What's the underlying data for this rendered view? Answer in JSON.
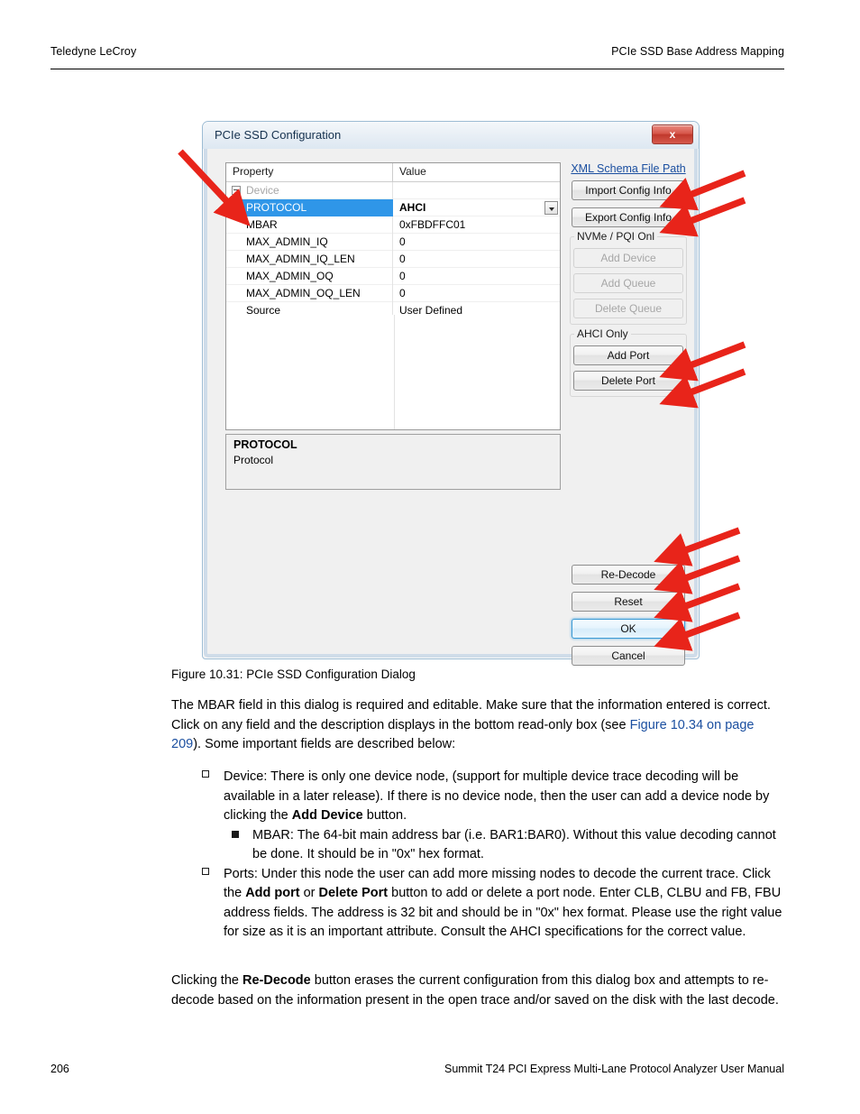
{
  "page": {
    "header_left": "Teledyne LeCroy",
    "header_right": "PCIe SSD Base Address Mapping",
    "footer_page_number": "206",
    "footer_right": "Summit T24 PCI Express Multi-Lane Protocol Analyzer User Manual"
  },
  "dialog": {
    "title": "PCIe SSD Configuration",
    "close_label": "x",
    "grid": {
      "columns": [
        "Property",
        "Value"
      ],
      "rows": [
        {
          "property": "Device",
          "value": "",
          "type": "group",
          "expanded": true
        },
        {
          "property": "PROTOCOL",
          "value": "AHCI",
          "type": "selected-combo"
        },
        {
          "property": "MBAR",
          "value": "0xFBDFFC01",
          "type": "normal"
        },
        {
          "property": "MAX_ADMIN_IQ",
          "value": "0",
          "type": "normal"
        },
        {
          "property": "MAX_ADMIN_IQ_LEN",
          "value": "0",
          "type": "normal"
        },
        {
          "property": "MAX_ADMIN_OQ",
          "value": "0",
          "type": "normal"
        },
        {
          "property": "MAX_ADMIN_OQ_LEN",
          "value": "0",
          "type": "normal"
        },
        {
          "property": "Source",
          "value": "User Defined",
          "type": "normal"
        }
      ]
    },
    "description": {
      "title": "PROTOCOL",
      "text": "Protocol"
    },
    "side": {
      "xml_link": "XML Schema File Path",
      "import_button": "Import Config Info",
      "export_button": "Export Config Info",
      "nvme_group_label": "NVMe / PQI Onl",
      "add_device_button": "Add Device",
      "add_queue_button": "Add Queue",
      "delete_queue_button": "Delete Queue",
      "ahci_group_label": "AHCI Only",
      "add_port_button": "Add Port",
      "delete_port_button": "Delete Port"
    },
    "actions": {
      "redecode_button": "Re-Decode",
      "reset_button": "Reset",
      "ok_button": "OK",
      "cancel_button": "Cancel"
    },
    "accent_colors": {
      "selection_blue": "#2f96e8",
      "default_button_border": "#3c9ad4",
      "close_button_red": "#c0392c",
      "annotation_arrow_red": "#e8241a",
      "link_blue": "#1b4fa0"
    }
  },
  "figure": {
    "caption": "Figure 10.31:  PCIe SSD Configuration Dialog"
  },
  "body": {
    "paragraph_1_a": "The MBAR field in this dialog is required and editable. Make sure that the information entered is correct. Click on any field and the description displays in the bottom read-only box (see ",
    "paragraph_1_link": "Figure 10.34 on page 209",
    "paragraph_1_b": "). Some important fields are described below:",
    "bullet_device_a": "Device: There is only one device node, (support for multiple device trace decoding will be available in a later release). If there is no device node, then the user can add a device node by clicking the ",
    "bullet_device_bold": "Add Device",
    "bullet_device_b": " button.",
    "bullet_mbar": "MBAR: The 64-bit main address bar (i.e. BAR1:BAR0). Without this value decoding cannot be done. It should be in \"0x\" hex format.",
    "bullet_ports_a": "Ports: Under this node the user can add more missing nodes to decode the current trace. Click the ",
    "bullet_ports_bold1": "Add port",
    "bullet_ports_mid": " or ",
    "bullet_ports_bold2": "Delete Port",
    "bullet_ports_b": " button to add or delete a port node. Enter CLB, CLBU and FB, FBU address fields. The address is 32 bit and should be in \"0x\" hex format. Please use the right value for size as it is an important attribute. Consult the AHCI specifications for the correct value.",
    "paragraph_2_a": "Clicking the ",
    "paragraph_2_bold": "Re-Decode",
    "paragraph_2_b": " button erases the current configuration from this dialog box and attempts to re-decode based on the information present in the open trace and/or saved on the disk with the last decode."
  }
}
